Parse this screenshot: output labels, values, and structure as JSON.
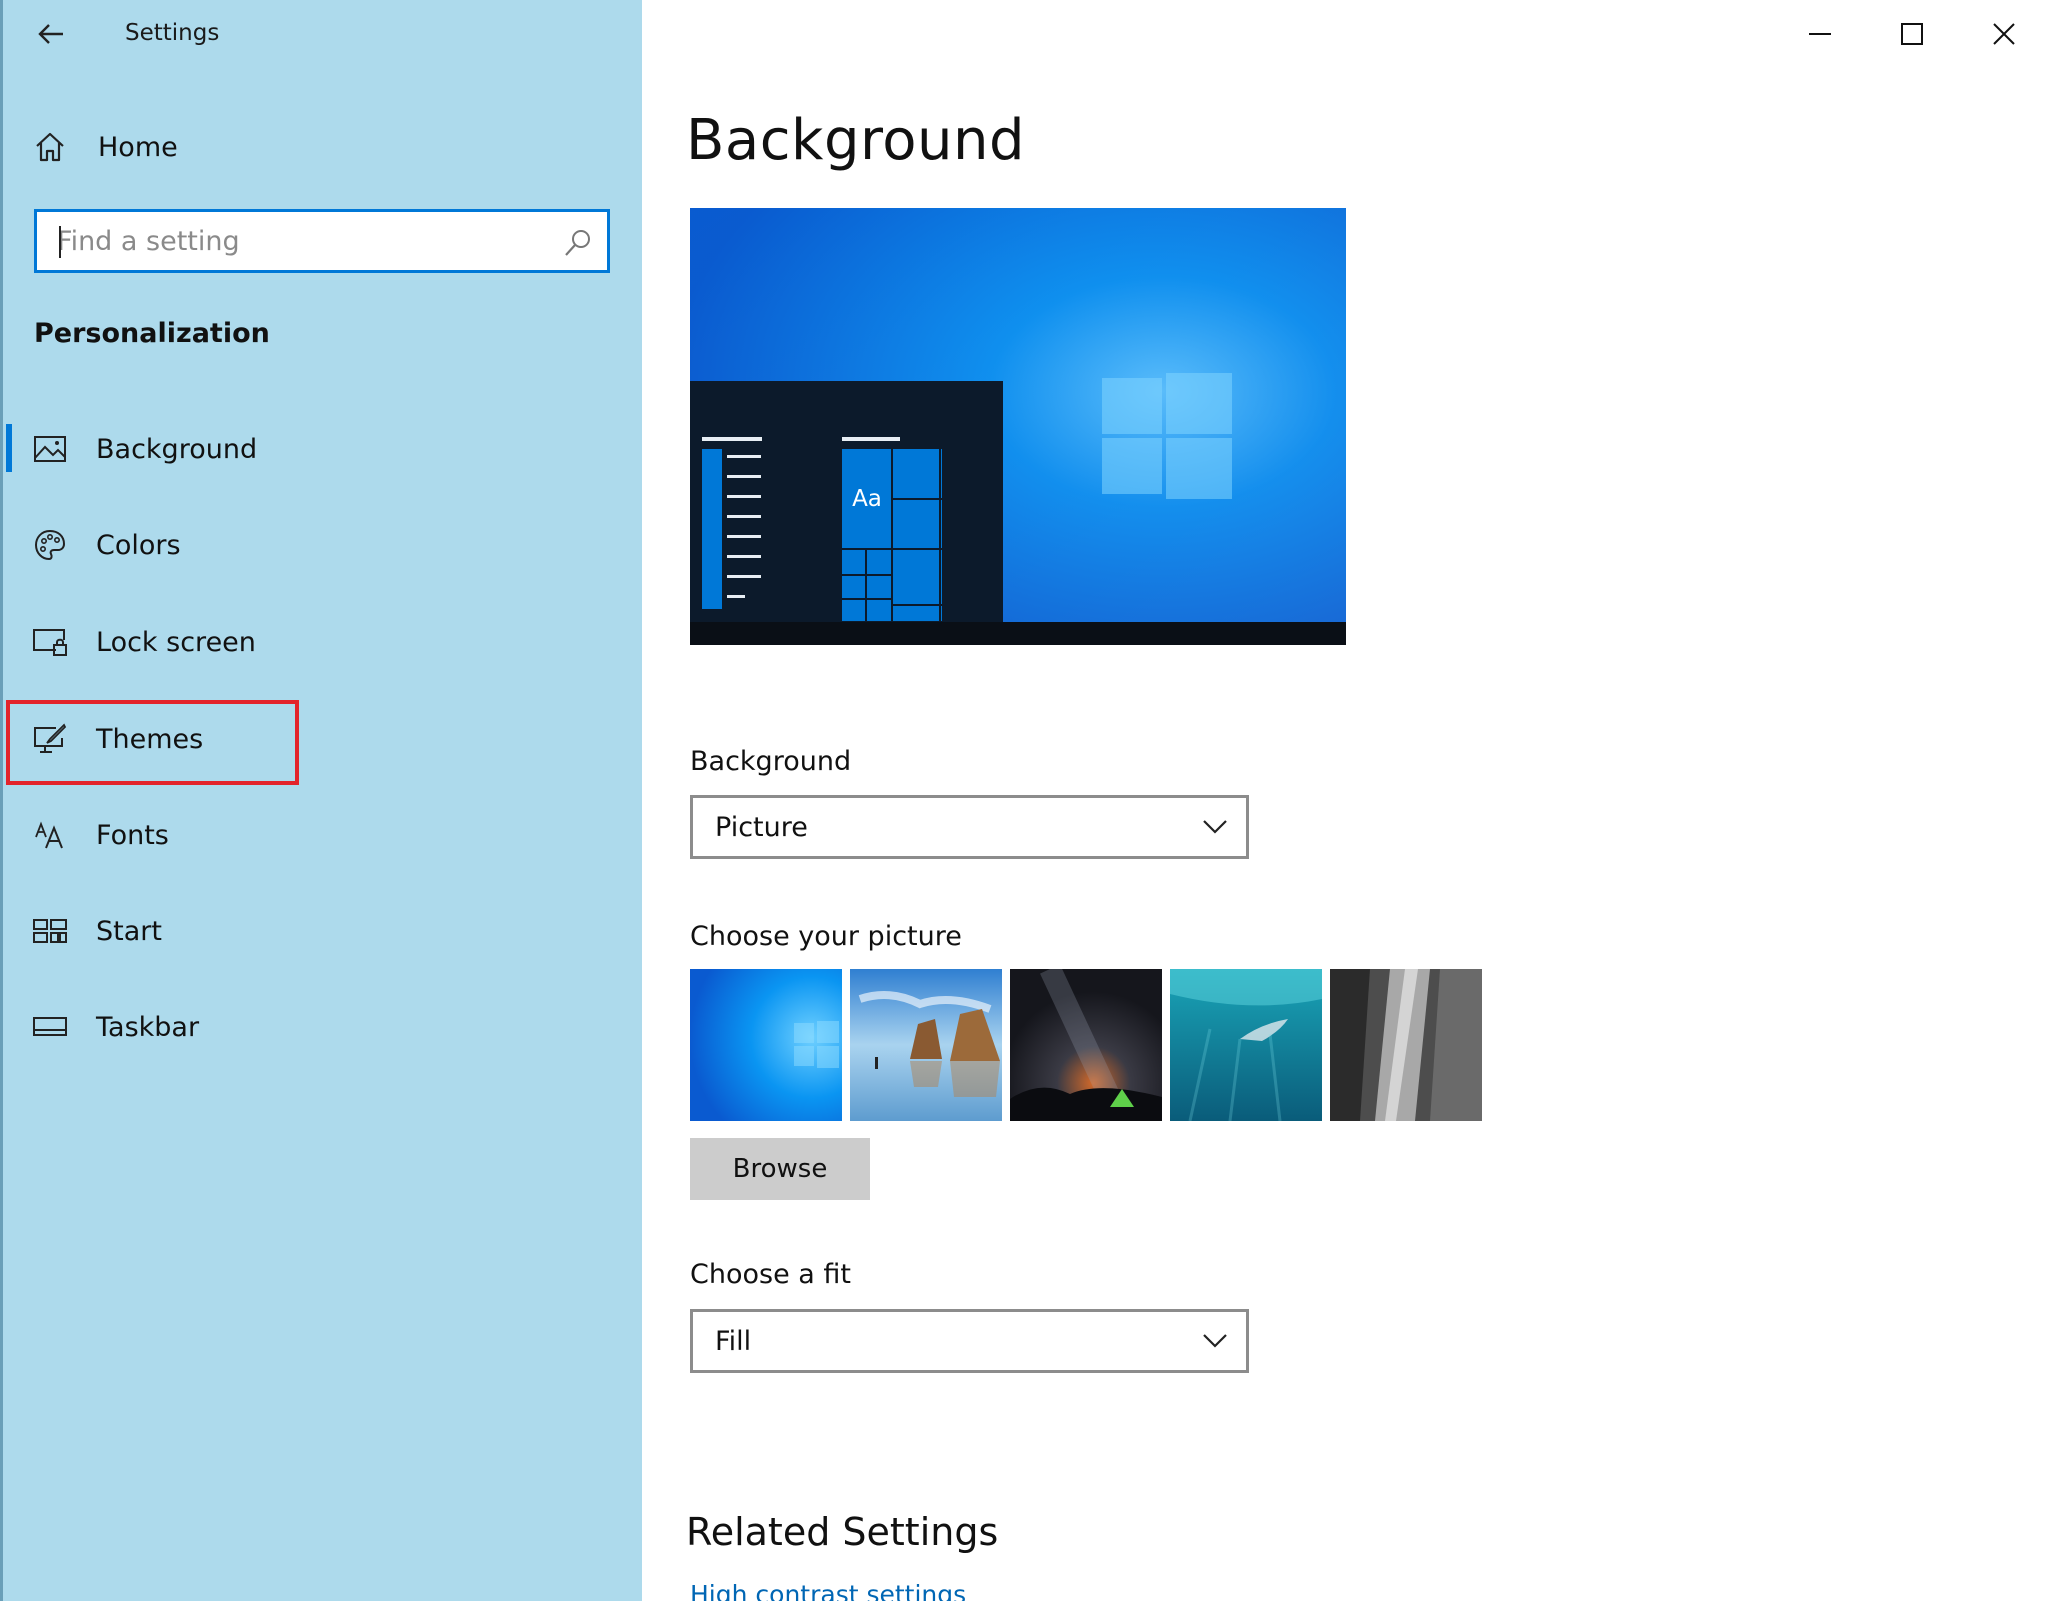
{
  "window": {
    "title": "Settings"
  },
  "sidebar": {
    "home_label": "Home",
    "search_placeholder": "Find a setting",
    "section_title": "Personalization",
    "items": [
      {
        "label": "Background",
        "icon": "picture-icon",
        "selected": true
      },
      {
        "label": "Colors",
        "icon": "palette-icon"
      },
      {
        "label": "Lock screen",
        "icon": "lock-screen-icon"
      },
      {
        "label": "Themes",
        "icon": "themes-icon",
        "highlighted": true
      },
      {
        "label": "Fonts",
        "icon": "fonts-icon"
      },
      {
        "label": "Start",
        "icon": "start-icon"
      },
      {
        "label": "Taskbar",
        "icon": "taskbar-icon"
      }
    ]
  },
  "main": {
    "title": "Background",
    "preview_tile_text": "Aa",
    "background_label": "Background",
    "background_value": "Picture",
    "choose_picture_label": "Choose your picture",
    "browse_label": "Browse",
    "choose_fit_label": "Choose a fit",
    "fit_value": "Fill",
    "related_title": "Related Settings",
    "high_contrast_link": "High contrast settings"
  },
  "colors": {
    "sidebar_bg": "#ADDAEC",
    "accent": "#0078D7",
    "highlight_box": "#E3242B",
    "link": "#0066B4"
  }
}
